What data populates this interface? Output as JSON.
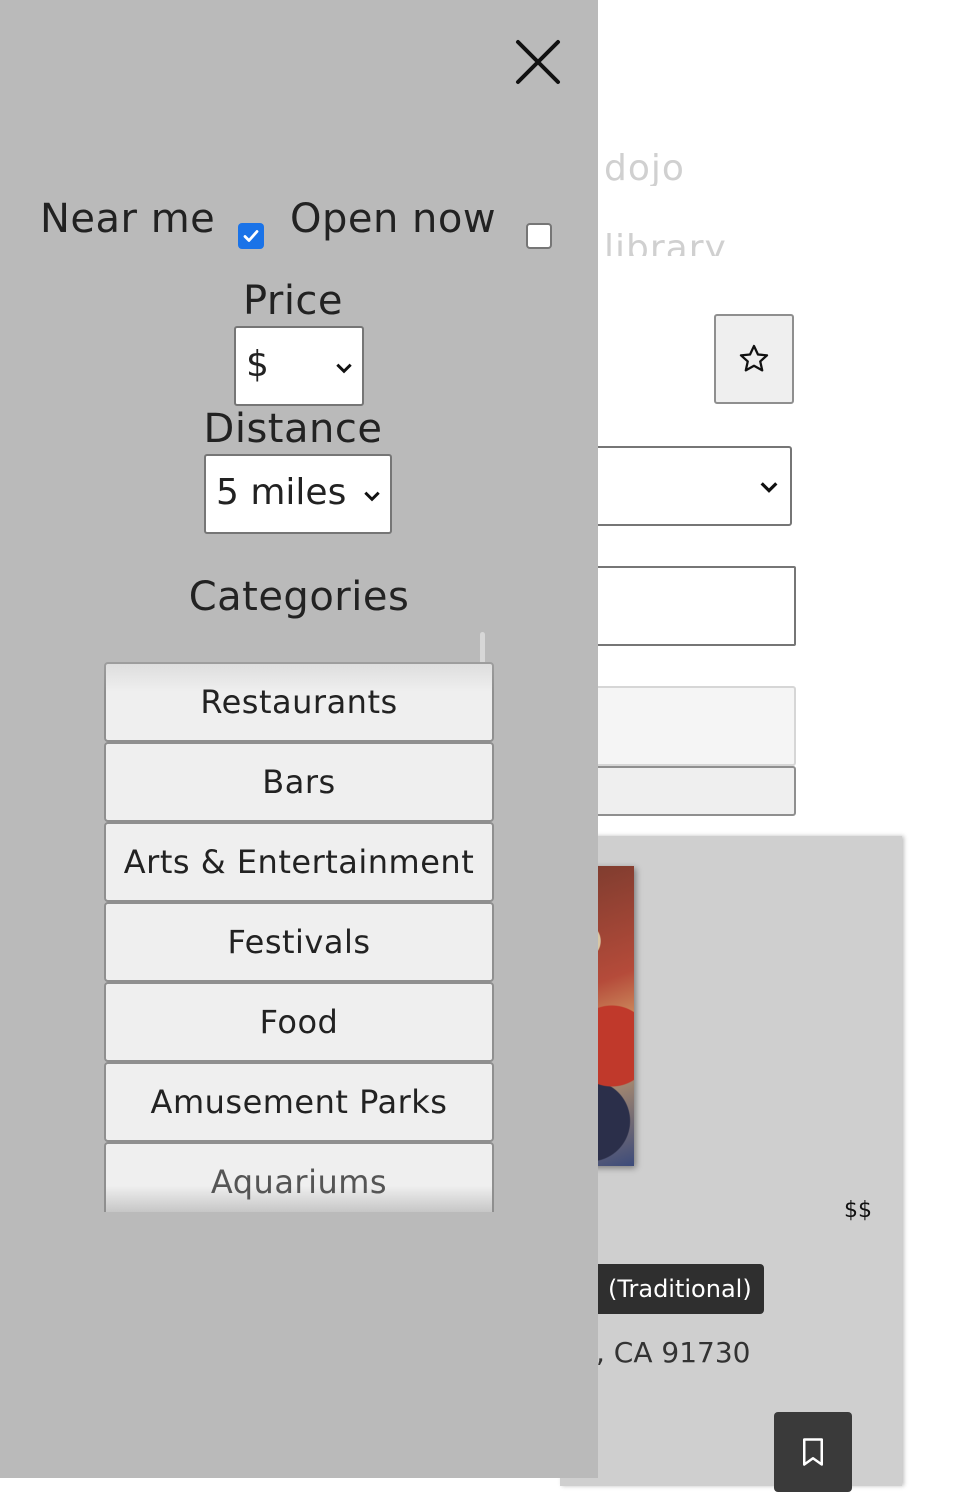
{
  "background": {
    "faded_text_1": "dojo",
    "faded_text_2": "library",
    "favorite_icon": "star-icon",
    "card": {
      "price": "$$",
      "tag": "(Traditional)",
      "address": ", CA 91730",
      "bookmark_icon": "bookmark-icon"
    }
  },
  "drawer": {
    "close_icon": "close-icon",
    "near_me": {
      "label": "Near me",
      "checked": true
    },
    "open_now": {
      "label": "Open now",
      "checked": false
    },
    "price": {
      "label": "Price",
      "selected": "$"
    },
    "distance": {
      "label": "Distance",
      "selected": "5 miles"
    },
    "categories": {
      "label": "Categories",
      "items": [
        "Restaurants",
        "Bars",
        "Arts & Entertainment",
        "Festivals",
        "Food",
        "Amusement Parks",
        "Aquariums"
      ]
    }
  },
  "colors": {
    "drawer_bg": "#bababa",
    "checkbox_accent": "#1a73e8",
    "card_bg": "#cfcfcf",
    "tag_bg": "#2f2f2f"
  }
}
